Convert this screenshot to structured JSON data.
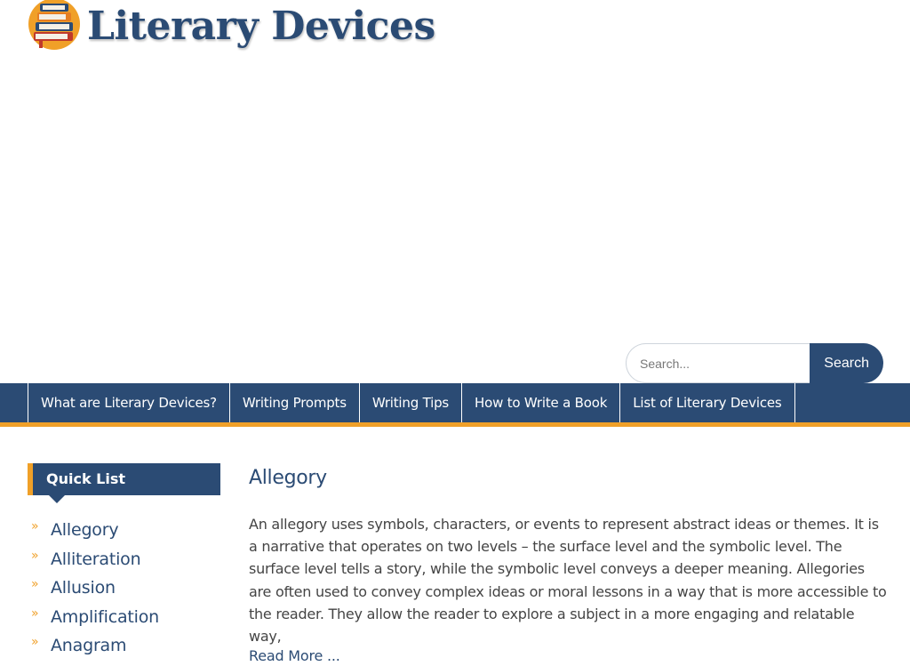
{
  "header": {
    "site_title": "Literary Devices",
    "logo_icon": "books-stack-icon",
    "colors": {
      "brand_blue": "#2b4b74",
      "accent_orange": "#f0a028"
    }
  },
  "search": {
    "placeholder": "Search...",
    "value": "",
    "button_label": "Search"
  },
  "nav": {
    "items": [
      {
        "label": "What are Literary Devices?"
      },
      {
        "label": "Writing Prompts"
      },
      {
        "label": "Writing Tips"
      },
      {
        "label": "How to Write a Book"
      },
      {
        "label": "List of Literary Devices"
      }
    ]
  },
  "sidebar": {
    "title": "Quick List",
    "items": [
      {
        "label": "Allegory"
      },
      {
        "label": "Alliteration"
      },
      {
        "label": "Allusion"
      },
      {
        "label": "Amplification"
      },
      {
        "label": "Anagram"
      }
    ]
  },
  "article": {
    "title": "Allegory",
    "body": "An allegory uses symbols, characters, or events to represent abstract ideas or themes. It is a narrative that operates on two levels – the surface level and the symbolic level. The surface level tells a story, while the symbolic level conveys a deeper meaning. Allegories are often used to convey complex ideas or moral lessons in a way that is more accessible to the reader. They allow the reader to explore a subject in a more engaging and relatable way,",
    "read_more": "Read More ..."
  }
}
